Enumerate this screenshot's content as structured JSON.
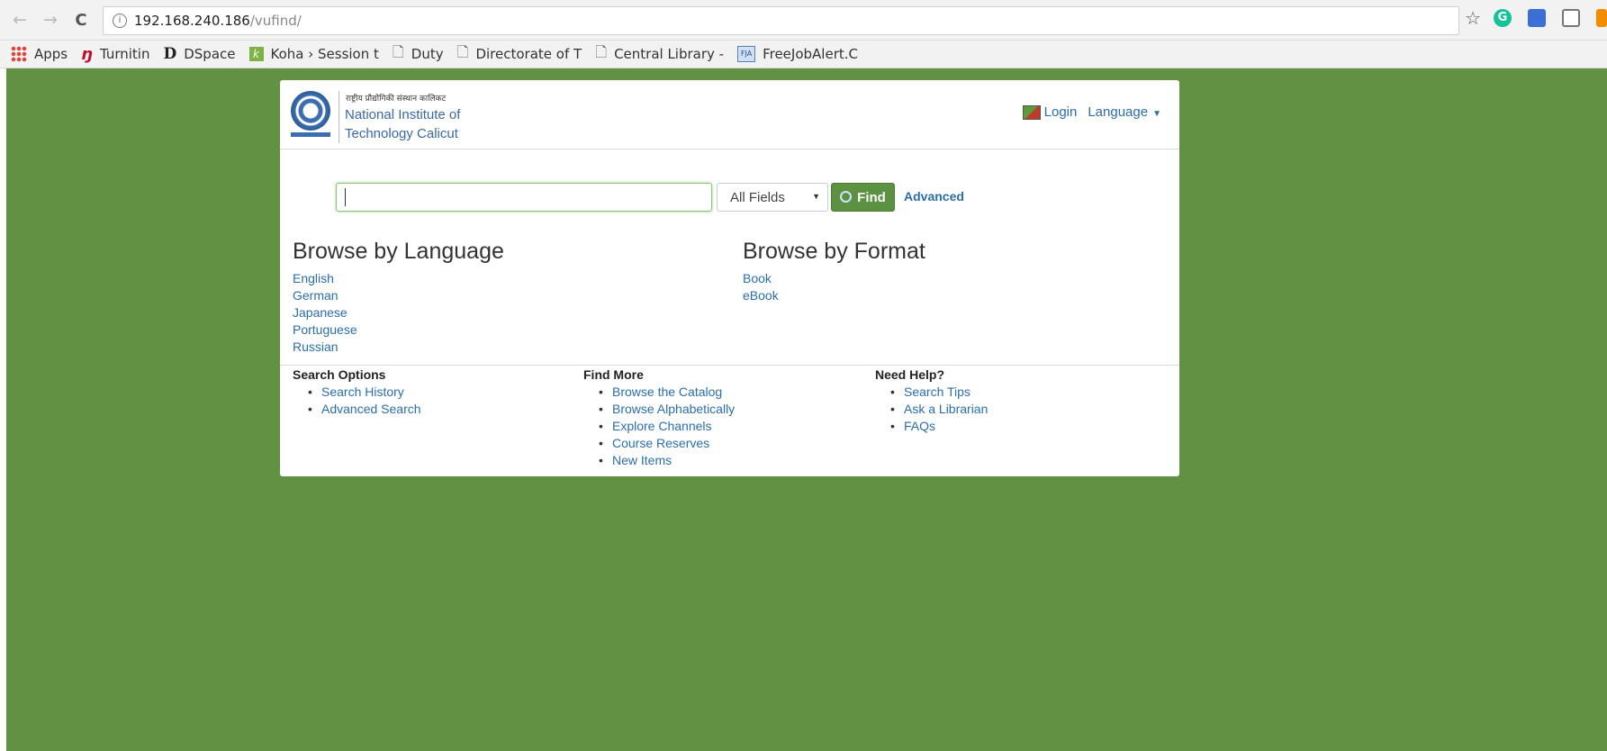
{
  "browser": {
    "url_host": "192.168.240.186",
    "url_path": "/vufind/",
    "bookmarks": [
      {
        "label": "Apps",
        "icon": "apps-grid-icon"
      },
      {
        "label": "Turnitin",
        "icon": "turnitin-icon"
      },
      {
        "label": "DSpace",
        "icon": "dspace-icon"
      },
      {
        "label": "Koha › Session t",
        "icon": "koha-icon"
      },
      {
        "label": "Duty",
        "icon": "page-icon"
      },
      {
        "label": "Directorate of T",
        "icon": "page-icon"
      },
      {
        "label": "Central Library -",
        "icon": "page-icon"
      },
      {
        "label": "FreeJobAlert.C",
        "icon": "freejobalert-icon"
      }
    ]
  },
  "header": {
    "hindi_name": "राष्ट्रीय प्रौद्योगिकी संस्थान कालिकट",
    "title_line1": "National Institute of",
    "title_line2": "Technology Calicut",
    "login": "Login",
    "language": "Language"
  },
  "search": {
    "value": "",
    "field": "All Fields",
    "find_label": "Find",
    "advanced_label": "Advanced"
  },
  "browse_language": {
    "heading": "Browse by Language",
    "items": [
      "English",
      "German",
      "Japanese",
      "Portuguese",
      "Russian"
    ]
  },
  "browse_format": {
    "heading": "Browse by Format",
    "items": [
      "Book",
      "eBook"
    ]
  },
  "footer": {
    "search_options": {
      "title": "Search Options",
      "items": [
        "Search History",
        "Advanced Search"
      ]
    },
    "find_more": {
      "title": "Find More",
      "items": [
        "Browse the Catalog",
        "Browse Alphabetically",
        "Explore Channels",
        "Course Reserves",
        "New Items"
      ]
    },
    "need_help": {
      "title": "Need Help?",
      "items": [
        "Search Tips",
        "Ask a Librarian",
        "FAQs"
      ]
    }
  },
  "colors": {
    "page_background": "#629143",
    "link": "#2b6eab",
    "find_button": "#5b9141"
  }
}
